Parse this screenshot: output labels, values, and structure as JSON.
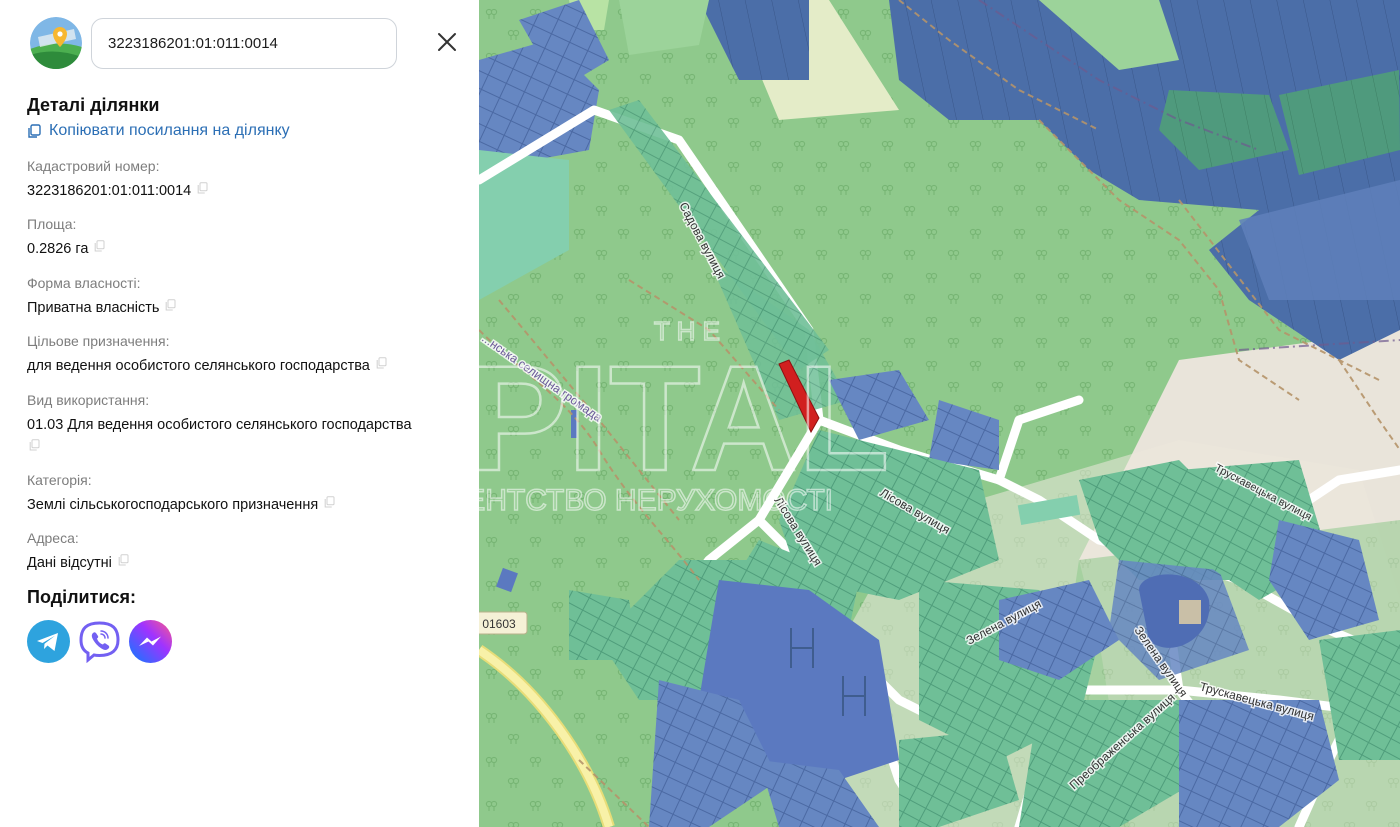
{
  "search": {
    "value": "3223186201:01:011:0014"
  },
  "details": {
    "title": "Деталі ділянки",
    "copy_link": "Копіювати посилання на ділянку",
    "fields": [
      {
        "label": "Кадастровий номер:",
        "value": "3223186201:01:011:0014"
      },
      {
        "label": "Площа:",
        "value": "0.2826 га"
      },
      {
        "label": "Форма власності:",
        "value": "Приватна власність"
      },
      {
        "label": "Цільове призначення:",
        "value": "для ведення особистого селянського господарства"
      },
      {
        "label": "Вид використання:",
        "value": "01.03 Для ведення особистого селянського господарства"
      },
      {
        "label": "Категорія:",
        "value": "Землі сільськогосподарського призначення"
      },
      {
        "label": "Адреса:",
        "value": "Дані відсутні"
      }
    ]
  },
  "share": {
    "title": "Поділитися:",
    "buttons": [
      "telegram-icon",
      "viber-icon",
      "messenger-icon"
    ]
  },
  "map": {
    "streets": [
      "Садова вулиця",
      "Лісова вулиця",
      "Лісова вулиця",
      "Зелена вулиця",
      "Зелена вулиця",
      "Преображенська вулиця",
      "Трускавецька вулиця"
    ],
    "boundary_label": "...нська селищна громада",
    "road_badge": "01603",
    "watermark_top": "T H E",
    "watermark_main": "APITAL",
    "watermark_sub": "АГЕНТСТВО НЕРУХОМОСТІ",
    "colors": {
      "forest": "#8fc98c",
      "parcel_blue": "#5a7bb0",
      "parcel_teal": "#6fbf97",
      "selected": "#d11f1f",
      "road": "#ffffff",
      "highway": "#f2ea9a"
    }
  }
}
